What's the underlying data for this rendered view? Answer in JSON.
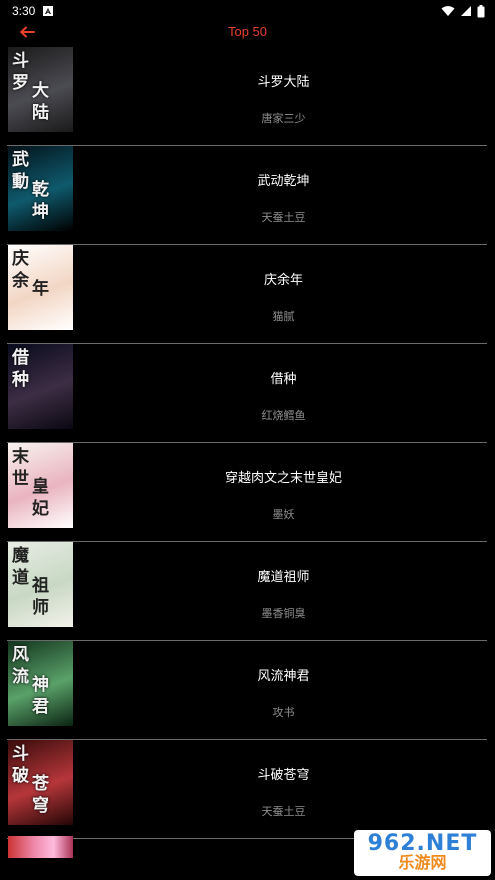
{
  "status_bar": {
    "time": "3:30",
    "notification_icon": "a-icon",
    "icons": [
      "wifi-icon",
      "signal-icon",
      "battery-icon"
    ]
  },
  "header": {
    "title": "Top 50",
    "back_icon": "arrow-left-icon",
    "accent_color": "#e8412c"
  },
  "books": [
    {
      "title": "斗罗大陆",
      "author": "唐家三少",
      "cover_text": "斗罗大陆",
      "cover_colors": [
        "#1b1a1a",
        "#4b4b52",
        "#1a1a1a"
      ]
    },
    {
      "title": "武动乾坤",
      "author": "天蚕土豆",
      "cover_text": "武動乾坤",
      "cover_colors": [
        "#04121a",
        "#0f5a6d",
        "#000000"
      ]
    },
    {
      "title": "庆余年",
      "author": "猫腻",
      "cover_text": "庆余年",
      "cover_colors": [
        "#ffffff",
        "#f2d6c4",
        "#ffffff"
      ]
    },
    {
      "title": "借种",
      "author": "红烧鳕鱼",
      "cover_text": "借种",
      "cover_colors": [
        "#090b1d",
        "#3d2d44",
        "#0a0812"
      ]
    },
    {
      "title": "穿越肉文之末世皇妃",
      "author": "墨妖",
      "cover_text": "末世皇妃",
      "cover_colors": [
        "#f8f3ee",
        "#e9b4c0",
        "#ffffff"
      ]
    },
    {
      "title": "魔道祖师",
      "author": "墨香铜臭",
      "cover_text": "魔道祖师",
      "cover_colors": [
        "#e7ece4",
        "#c8d8c4",
        "#f3f2ea"
      ]
    },
    {
      "title": "风流神君",
      "author": "攻书",
      "cover_text": "风流神君",
      "cover_colors": [
        "#13351e",
        "#5aa169",
        "#0b2413"
      ]
    },
    {
      "title": "斗破苍穹",
      "author": "天蚕土豆",
      "cover_text": "斗破苍穹",
      "cover_colors": [
        "#3a0c0c",
        "#b6363a",
        "#240606"
      ]
    }
  ],
  "watermark": {
    "brand": "962.NET",
    "subtitle": "乐游网"
  }
}
